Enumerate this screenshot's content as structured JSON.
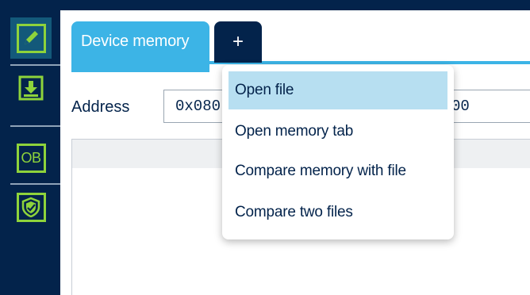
{
  "sidebar": {
    "items": [
      {
        "name": "edit-icon",
        "active": true
      },
      {
        "name": "download-icon",
        "active": false
      },
      {
        "name": "option-bytes",
        "label": "OB",
        "active": false
      },
      {
        "name": "security-shield-icon",
        "active": false
      }
    ]
  },
  "tabs": {
    "active_label": "Device memory",
    "add_label": "+"
  },
  "address": {
    "label": "Address",
    "value_visible": "0x080",
    "value_suffix": "00"
  },
  "dropdown": {
    "items": [
      {
        "label": "Open file",
        "hover": true
      },
      {
        "label": "Open memory tab",
        "hover": false
      },
      {
        "label": "Compare memory with file",
        "hover": false
      },
      {
        "label": "Compare two files",
        "hover": false
      }
    ]
  },
  "colors": {
    "navy": "#03234b",
    "tab_blue": "#3cb4e6",
    "icon_green": "#8ed33b",
    "hover_blue": "#b7dff1"
  }
}
